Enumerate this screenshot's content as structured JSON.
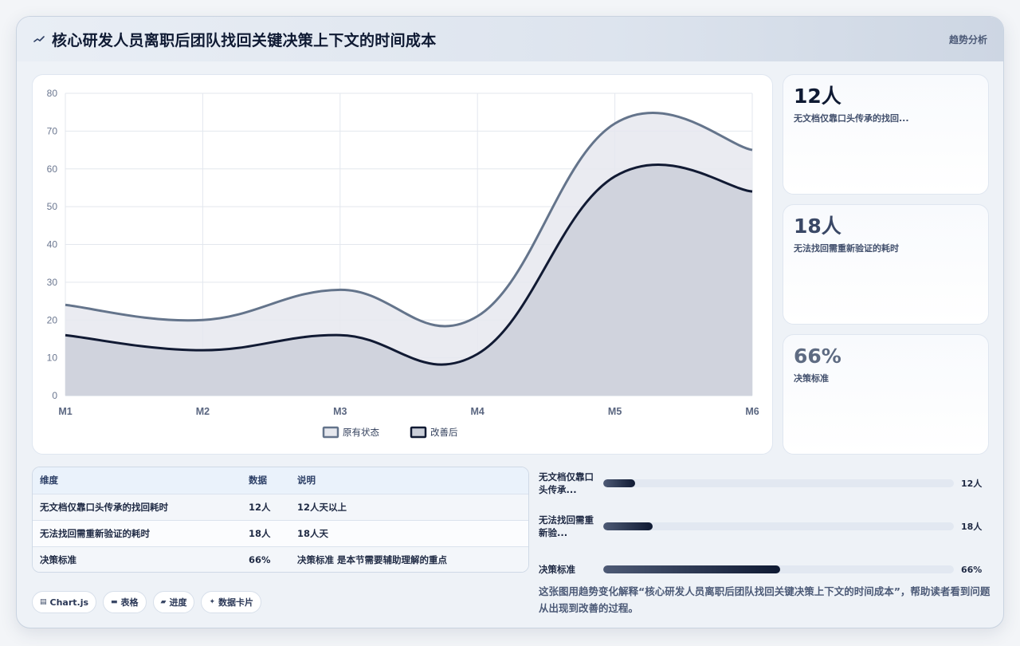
{
  "header": {
    "title": "核心研发人员离职后团队找回关键决策上下文的时间成本",
    "logo_icon": "sparkline-icon",
    "right_label": "趋势分析"
  },
  "chart_data": {
    "type": "area",
    "categories": [
      "M1",
      "M2",
      "M3",
      "M4",
      "M5",
      "M6"
    ],
    "ylim": [
      0,
      80
    ],
    "yticks": [
      0,
      10,
      20,
      30,
      40,
      50,
      60,
      70,
      80
    ],
    "grid": true,
    "legend_position": "bottom",
    "title": "",
    "xlabel": "",
    "ylabel": "",
    "series": [
      {
        "name": "原有状态",
        "values": [
          24,
          20,
          28,
          21,
          72,
          65
        ],
        "line_color": "#64748b",
        "fill_color": "#e6e8ee"
      },
      {
        "name": "改善后",
        "values": [
          16,
          12,
          16,
          11,
          58,
          54
        ],
        "line_color": "#111a33",
        "fill_color": "#cbcfd9"
      }
    ]
  },
  "stats": [
    {
      "value": "12人",
      "label": "无文档仅靠口头传承的找回...",
      "color": "#0f1a33"
    },
    {
      "value": "18人",
      "label": "无法找回需重新验证的耗时",
      "color": "#3a4866"
    },
    {
      "value": "66%",
      "label": "决策标准",
      "color": "#5e6b82"
    }
  ],
  "table": {
    "headers": [
      "维度",
      "数据",
      "说明"
    ],
    "rows": [
      [
        "无文档仅靠口头传承的找回耗时",
        "12人",
        "12人天以上"
      ],
      [
        "无法找回需重新验证的耗时",
        "18人",
        "18人天"
      ],
      [
        "决策标准",
        "66%",
        "决策标准 是本节需要辅助理解的重点"
      ]
    ]
  },
  "tags": [
    {
      "icon": "chart-icon",
      "glyph": "▤",
      "label": "Chart.js"
    },
    {
      "icon": "table-icon",
      "glyph": "▬",
      "label": "表格"
    },
    {
      "icon": "progress-icon",
      "glyph": "▰",
      "label": "进度"
    },
    {
      "icon": "card-icon",
      "glyph": "✦",
      "label": "数据卡片"
    }
  ],
  "progress": [
    {
      "label": "无文档仅靠口头传承...",
      "value_text": "12人",
      "fraction": 0.09
    },
    {
      "label": "无法找回需重新验...",
      "value_text": "18人",
      "fraction": 0.14
    },
    {
      "label": "决策标准",
      "value_text": "66%",
      "fraction": 0.505
    }
  ],
  "caption": "这张图用趋势变化解释“核心研发人员离职后团队找回关键决策上下文的时间成本”，帮助读者看到问题从出现到改善的过程。"
}
